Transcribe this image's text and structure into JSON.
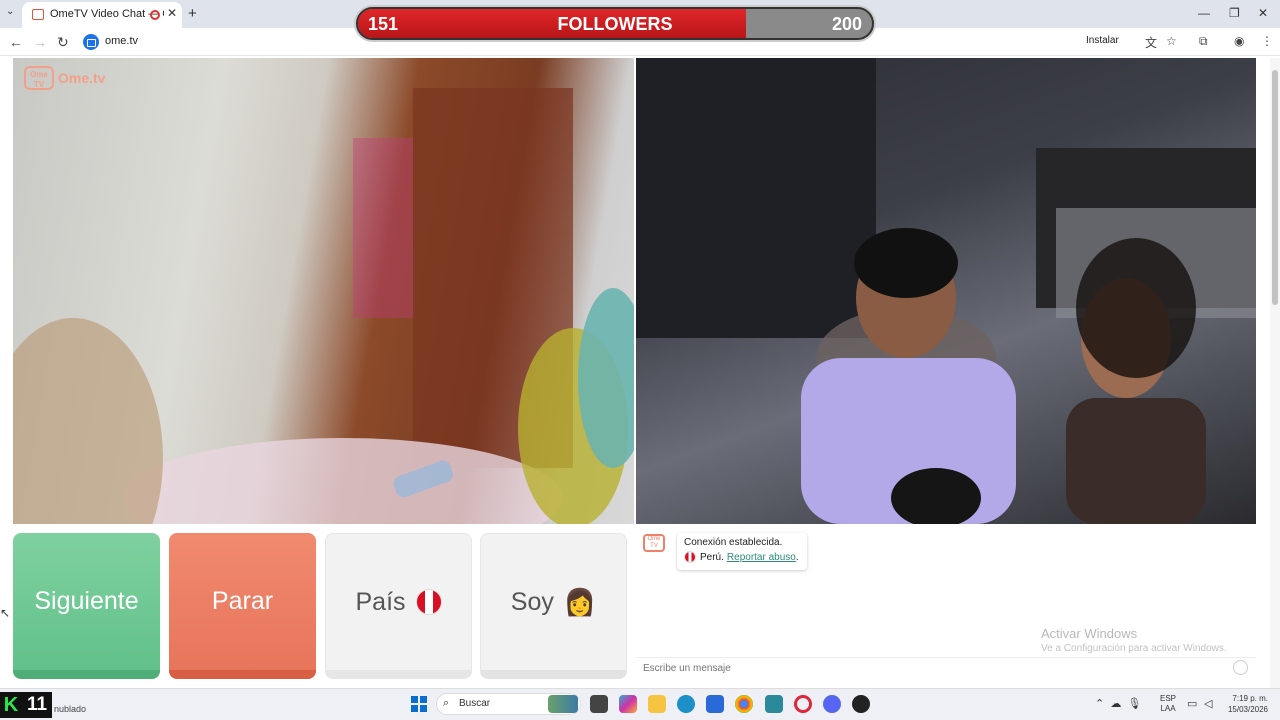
{
  "browser": {
    "tab_title": "OmeTV Video Chat — Ome",
    "tab_close": "✕",
    "new_tab": "+",
    "tab_menu": "⌄",
    "url": "ome.tv",
    "install_label": "Instalar",
    "window_controls": [
      "—",
      "❐",
      "✕"
    ]
  },
  "followers_bar": {
    "current": "151",
    "label": "FOLLOWERS",
    "goal": "200",
    "progress_fraction": 0.755,
    "fill_color": "#d41c20"
  },
  "logo": {
    "badge": "Ome TV",
    "text": "Ome.tv"
  },
  "controls": {
    "next_label": "Siguiente",
    "stop_label": "Parar",
    "country_label": "País",
    "gender_label": "Soy",
    "gender_emoji": "👩"
  },
  "chat": {
    "logo": "Ome TV",
    "status": "Conexión establecida.",
    "country": "Perú.",
    "report_link": "Reportar abuso",
    "report_punct": ".",
    "input_placeholder": "Escribe un mensaje"
  },
  "watermark": {
    "title": "Activar Windows",
    "subtitle": "Ve a Configuración para activar Windows."
  },
  "taskbar": {
    "k_badge": "K",
    "k_number": "11",
    "weather": "nublado",
    "search_label": "Buscar",
    "language_line1": "ESP",
    "language_line2": "LAA",
    "time": "7:19 p. m.",
    "date": "15/03/2026"
  }
}
